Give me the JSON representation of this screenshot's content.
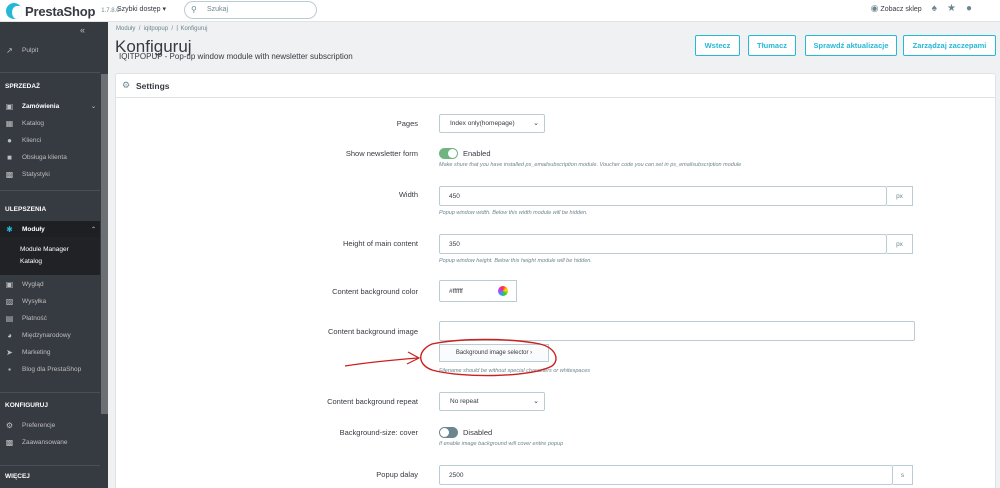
{
  "header": {
    "brand": "PrestaShop",
    "version": "1.7.8.0",
    "quick_access": "Szybki dostęp ▾",
    "search_placeholder": "Szukaj",
    "view_store": "Zobacz sklep"
  },
  "sidebar": {
    "dashboard": "Pulpit",
    "section_sell": "SPRZEDAŻ",
    "orders": "Zamówienia",
    "catalog": "Katalog",
    "customers": "Klienci",
    "customer_service": "Obsługa klienta",
    "stats": "Statystyki",
    "section_improve": "ULEPSZENIA",
    "modules": "Moduły",
    "module_manager": "Module Manager",
    "module_catalog": "Katalog",
    "design": "Wygląd",
    "shipping": "Wysyłka",
    "payment": "Płatność",
    "international": "Międzynarodowy",
    "marketing": "Marketing",
    "blog": "Blog dla PrestaShop",
    "section_configure": "KONFIGURUJ",
    "preferences": "Preferencje",
    "advanced": "Zaawansowane",
    "section_more": "WIĘCEJ"
  },
  "breadcrumb": {
    "crumb1": "Moduły",
    "sep": "/",
    "crumb2": "iqitpopup",
    "crumb3": "Konfiguruj"
  },
  "page": {
    "title": "Konfiguruj",
    "subtitle": "IQITPOPUP - Pop-up window module with newsletter subscription"
  },
  "toolbar": {
    "back": "Wstecz",
    "translate": "Tłumacz",
    "check_update": "Sprawdź aktualizacje",
    "manage_hooks": "Zarządzaj zaczepami"
  },
  "settings": {
    "title": "Settings",
    "pages_label": "Pages",
    "pages_value": "Index only(homepage)",
    "newsletter_label": "Show newsletter form",
    "newsletter_state": "Enabled",
    "newsletter_help": "Make shure that you have installed ps_emailsubscription module. Voucher code you can set in ps_emailsubscription module",
    "width_label": "Width",
    "width_value": "450",
    "width_unit": "px",
    "width_help": "Popup window width. Below this width module will be hidden.",
    "height_label": "Height of main content",
    "height_value": "350",
    "height_unit": "px",
    "height_help": "Popup window height. Below this height module will be hidden.",
    "bgcolor_label": "Content background color",
    "bgcolor_value": "#ffffff",
    "bgimage_label": "Content background image",
    "bgimage_value": "",
    "bgimage_button": "Background image selector ›",
    "bgimage_help": "Filename should be without special characters or whitespaces",
    "bgrepeat_label": "Content background repeat",
    "bgrepeat_value": "No repeat",
    "bgsize_label": "Background-size: cover",
    "bgsize_state": "Disabled",
    "bgsize_help": "If enable image background will cover entire popup",
    "delay_label": "Popup dalay",
    "delay_value": "2500",
    "delay_unit": "s"
  },
  "colors": {
    "accent": "#25b9d7",
    "switch_on": "#70b580",
    "switch_off": "#6c868e",
    "annotation": "#cc1f1f"
  }
}
